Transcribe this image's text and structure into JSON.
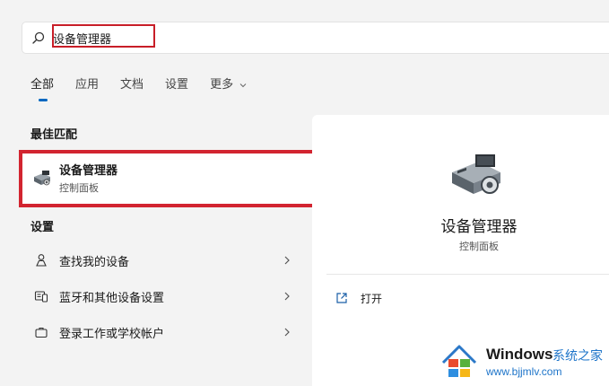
{
  "search": {
    "value": "设备管理器"
  },
  "tabs": [
    {
      "label": "全部",
      "active": true
    },
    {
      "label": "应用",
      "active": false
    },
    {
      "label": "文档",
      "active": false
    },
    {
      "label": "设置",
      "active": false
    },
    {
      "label": "更多",
      "active": false
    }
  ],
  "best_match": {
    "heading": "最佳匹配",
    "title": "设备管理器",
    "subtitle": "控制面板",
    "icon": "device-manager-icon"
  },
  "settings": {
    "heading": "设置",
    "items": [
      {
        "label": "查找我的设备",
        "icon": "person-location-icon"
      },
      {
        "label": "蓝牙和其他设备设置",
        "icon": "devices-icon"
      },
      {
        "label": "登录工作或学校帐户",
        "icon": "briefcase-icon"
      }
    ]
  },
  "detail": {
    "title": "设备管理器",
    "subtitle": "控制面板",
    "open_label": "打开"
  },
  "watermark": {
    "brand": "Windows",
    "cn": "系统之家",
    "url": "www.bjjmlv.com"
  },
  "colors": {
    "accent": "#0067c0",
    "highlight_red": "#d22430",
    "watermark_blue": "#1d74c9"
  }
}
